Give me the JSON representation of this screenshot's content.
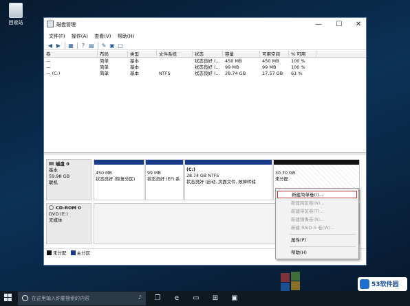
{
  "desktop": {
    "recycle_bin": "回收站"
  },
  "window": {
    "title": "磁盘管理",
    "buttons": {
      "minimize": "—",
      "maximize": "☐",
      "close": "✕"
    },
    "menu": [
      "文件(F)",
      "操作(A)",
      "查看(V)",
      "帮助(H)"
    ]
  },
  "volume_table": {
    "headers": [
      "卷",
      "布局",
      "类型",
      "文件系统",
      "状态",
      "容量",
      "可用空间",
      "% 可用"
    ],
    "rows": [
      [
        "—",
        "简单",
        "基本",
        "",
        "状态良好 (...",
        "450 MB",
        "450 MB",
        "100 %"
      ],
      [
        "—",
        "简单",
        "基本",
        "",
        "状态良好 (...",
        "99 MB",
        "99 MB",
        "100 %"
      ],
      [
        "— (C:)",
        "简单",
        "基本",
        "NTFS",
        "状态良好 (...",
        "28.74 GB",
        "17.57 GB",
        "61 %"
      ]
    ]
  },
  "disks": [
    {
      "name": "磁盘 0",
      "type": "基本",
      "size": "59.98 GB",
      "status": "联机",
      "partitions": [
        {
          "label": "",
          "size": "450 MB",
          "status": "状态良好 (恢复分区)"
        },
        {
          "label": "",
          "size": "99 MB",
          "status": "状态良好 (EFI 系"
        },
        {
          "label": "(C:)",
          "size": "28.74 GB NTFS",
          "status": "状态良好 (启动, 页面文件, 故障转储"
        },
        {
          "label": "",
          "size": "30.70 GB",
          "status": "未分配"
        }
      ]
    },
    {
      "name": "CD-ROM 0",
      "type": "DVD (E:)",
      "size": "",
      "status": "无媒体"
    }
  ],
  "legend": [
    {
      "label": "未分配",
      "color": "#111111"
    },
    {
      "label": "主分区",
      "color": "#1a3a8c"
    }
  ],
  "context_menu": [
    {
      "label": "新建简单卷(I)...",
      "enabled": true,
      "highlight": true
    },
    {
      "label": "新建跨区卷(N)...",
      "enabled": false
    },
    {
      "label": "新建带区卷(T)...",
      "enabled": false
    },
    {
      "label": "新建镜像卷(R)...",
      "enabled": false
    },
    {
      "label": "新建 RAID-5 卷(W)...",
      "enabled": false
    },
    {
      "label": "属性(P)",
      "enabled": true
    },
    {
      "label": "帮助(H)",
      "enabled": true
    }
  ],
  "taskbar": {
    "search_placeholder": "在这里输入你要搜索的内容"
  },
  "logo_text": "53软件园",
  "colors": {
    "primary_stripe": "#1a3a8c",
    "unallocated": "#111111",
    "highlight": "#c0353a"
  }
}
